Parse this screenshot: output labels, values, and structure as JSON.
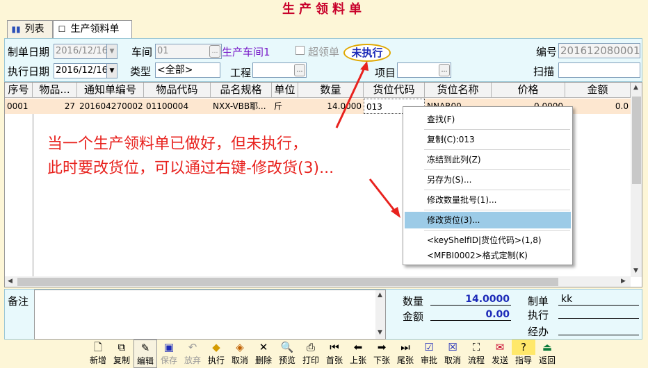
{
  "window": {
    "title": "生产领料单"
  },
  "tabs": [
    {
      "label": "列表",
      "icon": "bar-chart-icon"
    },
    {
      "label": "生产领料单",
      "icon": "form-icon"
    }
  ],
  "form": {
    "make_date_label": "制单日期",
    "make_date_value": "2016/12/16",
    "workshop_label": "车间",
    "workshop_value": "01",
    "workshop_name": "生产车间1",
    "over_issue_label": "超领单",
    "status": "未执行",
    "number_label": "编号",
    "number_value": "201612080001",
    "exec_date_label": "执行日期",
    "exec_date_value": "2016/12/16",
    "type_label": "类型",
    "type_value": "<全部>",
    "project_label": "工程",
    "project_value": "",
    "item_label": "项目",
    "item_value": "",
    "scan_label": "扫描",
    "scan_value": ""
  },
  "grid": {
    "columns": [
      "序号",
      "物品...",
      "通知单编号",
      "物品代码",
      "品名规格",
      "单位",
      "数量",
      "货位代码",
      "货位名称",
      "价格",
      "金额"
    ],
    "rows": [
      {
        "seq": "0001",
        "item_no": "27",
        "notice_no": "201604270002",
        "item_code": "01100004",
        "spec": "NXX-VBB耶...",
        "unit": "斤",
        "qty": "14.0000",
        "loc_code": "013",
        "loc_name": "NNAR00",
        "price": "0.0000",
        "amount": "0.0"
      }
    ]
  },
  "annotation": {
    "line1": "当一个生产领料单已做好，但未执行，",
    "line2": "此时要改货位，可以通过右键-修改货(3)..."
  },
  "context_menu": {
    "items": [
      {
        "label": "查找(F)"
      },
      {
        "label": "复制(C):013"
      },
      {
        "label": "冻结到此列(Z)"
      },
      {
        "label": "另存为(S)..."
      },
      {
        "label": "修改数量批号(1)..."
      },
      {
        "label": "修改货位(3)...",
        "selected": true
      },
      {
        "label": "<keyShelfID|货位代码>(1,8)"
      },
      {
        "label": "<MFBI0002>格式定制(K)"
      }
    ]
  },
  "bottom": {
    "notes_label": "备注",
    "qty_label": "数量",
    "qty_value": "14.0000",
    "amount_label": "金额",
    "amount_value": "0.00",
    "maker_label": "制单",
    "maker_value": "kk",
    "executor_label": "执行",
    "executor_value": "",
    "handler_label": "经办",
    "handler_value": ""
  },
  "toolbar": [
    {
      "label": "新增",
      "icon": "new-doc-icon"
    },
    {
      "label": "复制",
      "icon": "copy-icon"
    },
    {
      "label": "编辑",
      "icon": "edit-icon"
    },
    {
      "label": "保存",
      "icon": "save-icon",
      "disabled": true
    },
    {
      "label": "放弃",
      "icon": "undo-icon",
      "disabled": true
    },
    {
      "label": "执行",
      "icon": "execute-icon"
    },
    {
      "label": "取消",
      "icon": "cancel-exec-icon"
    },
    {
      "label": "删除",
      "icon": "delete-icon"
    },
    {
      "label": "预览",
      "icon": "preview-icon"
    },
    {
      "label": "打印",
      "icon": "print-icon"
    },
    {
      "label": "首张",
      "icon": "first-icon"
    },
    {
      "label": "上张",
      "icon": "prev-icon"
    },
    {
      "label": "下张",
      "icon": "next-icon"
    },
    {
      "label": "尾张",
      "icon": "last-icon"
    },
    {
      "label": "审批",
      "icon": "approve-icon"
    },
    {
      "label": "取消",
      "icon": "unapprove-icon"
    },
    {
      "label": "流程",
      "icon": "flow-icon"
    },
    {
      "label": "发送",
      "icon": "send-icon"
    },
    {
      "label": "指导",
      "icon": "help-icon"
    },
    {
      "label": "返回",
      "icon": "exit-icon"
    }
  ],
  "colors": {
    "accent_red": "#e8221e",
    "title_red": "#c8002a",
    "status_blue": "#1c2ab8",
    "row_highlight": "#fde7d0",
    "menu_select": "#9ccbe7"
  }
}
